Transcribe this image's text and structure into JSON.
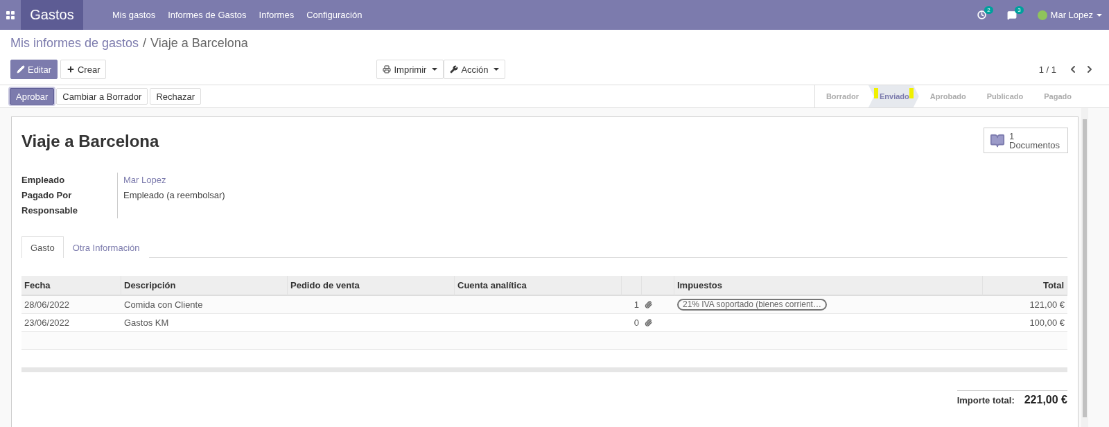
{
  "navbar": {
    "app_name": "Gastos",
    "menu": [
      "Mis gastos",
      "Informes de Gastos",
      "Informes",
      "Configuración"
    ],
    "activity_count": "2",
    "message_count": "3",
    "user": "Mar Lopez"
  },
  "breadcrumb": {
    "parent": "Mis informes de gastos",
    "separator": "/",
    "current": "Viaje a Barcelona"
  },
  "actions": {
    "edit": "Editar",
    "create": "Crear",
    "print": "Imprimir",
    "action": "Acción",
    "pager": "1 / 1"
  },
  "status_buttons": [
    {
      "label": "Aprobar",
      "kind": "primary"
    },
    {
      "label": "Cambiar a Borrador",
      "kind": "secondary"
    },
    {
      "label": "Rechazar",
      "kind": "secondary"
    }
  ],
  "stages": [
    {
      "label": "Borrador",
      "selected": false
    },
    {
      "label": "Enviado",
      "selected": true
    },
    {
      "label": "Aprobado",
      "selected": false
    },
    {
      "label": "Publicado",
      "selected": false
    },
    {
      "label": "Pagado",
      "selected": false
    }
  ],
  "sheet": {
    "title": "Viaje a Barcelona",
    "smart_button": {
      "count": "1",
      "label": "Documentos"
    },
    "fields": [
      {
        "label": "Empleado",
        "value": "Mar Lopez",
        "kind": "link"
      },
      {
        "label": "Pagado Por",
        "value": "Empleado (a reembolsar)",
        "kind": "text"
      },
      {
        "label": "Responsable",
        "kind": "text"
      }
    ],
    "tabs": [
      {
        "label": "Gasto",
        "selected": true
      },
      {
        "label": "Otra Información",
        "selected": false
      }
    ],
    "table": {
      "columns": [
        "Fecha",
        "Descripción",
        "Pedido de venta",
        "Cuenta analítica",
        "Impuestos",
        "Total"
      ],
      "rows": [
        {
          "date": "28/06/2022",
          "description": "Comida con Cliente",
          "attachments": "1",
          "tax": "21% IVA soportado (bienes corrient…",
          "total": "121,00 €"
        },
        {
          "date": "23/06/2022",
          "description": "Gastos KM",
          "attachments": "0",
          "total": "100,00 €"
        }
      ]
    },
    "total": {
      "label": "Importe total:",
      "value": "221,00 €"
    }
  }
}
